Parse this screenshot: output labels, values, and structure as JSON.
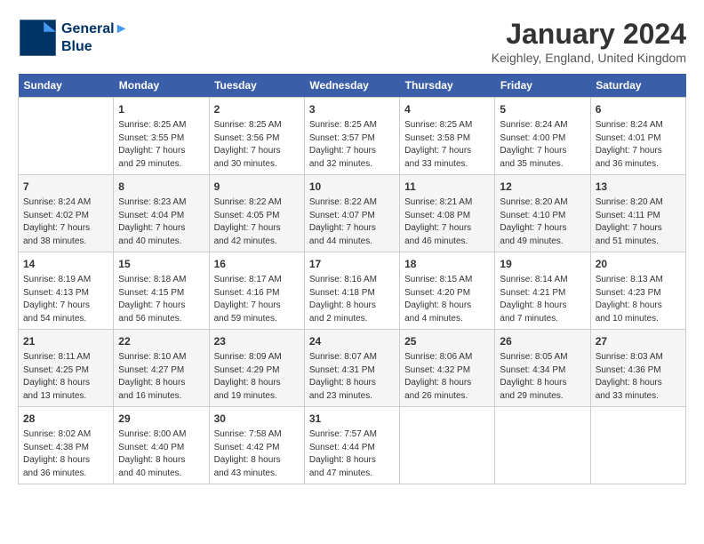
{
  "logo": {
    "line1": "General",
    "line2": "Blue"
  },
  "title": "January 2024",
  "location": "Keighley, England, United Kingdom",
  "days_of_week": [
    "Sunday",
    "Monday",
    "Tuesday",
    "Wednesday",
    "Thursday",
    "Friday",
    "Saturday"
  ],
  "weeks": [
    [
      {
        "day": "",
        "content": ""
      },
      {
        "day": "1",
        "content": "Sunrise: 8:25 AM\nSunset: 3:55 PM\nDaylight: 7 hours\nand 29 minutes."
      },
      {
        "day": "2",
        "content": "Sunrise: 8:25 AM\nSunset: 3:56 PM\nDaylight: 7 hours\nand 30 minutes."
      },
      {
        "day": "3",
        "content": "Sunrise: 8:25 AM\nSunset: 3:57 PM\nDaylight: 7 hours\nand 32 minutes."
      },
      {
        "day": "4",
        "content": "Sunrise: 8:25 AM\nSunset: 3:58 PM\nDaylight: 7 hours\nand 33 minutes."
      },
      {
        "day": "5",
        "content": "Sunrise: 8:24 AM\nSunset: 4:00 PM\nDaylight: 7 hours\nand 35 minutes."
      },
      {
        "day": "6",
        "content": "Sunrise: 8:24 AM\nSunset: 4:01 PM\nDaylight: 7 hours\nand 36 minutes."
      }
    ],
    [
      {
        "day": "7",
        "content": "Sunrise: 8:24 AM\nSunset: 4:02 PM\nDaylight: 7 hours\nand 38 minutes."
      },
      {
        "day": "8",
        "content": "Sunrise: 8:23 AM\nSunset: 4:04 PM\nDaylight: 7 hours\nand 40 minutes."
      },
      {
        "day": "9",
        "content": "Sunrise: 8:22 AM\nSunset: 4:05 PM\nDaylight: 7 hours\nand 42 minutes."
      },
      {
        "day": "10",
        "content": "Sunrise: 8:22 AM\nSunset: 4:07 PM\nDaylight: 7 hours\nand 44 minutes."
      },
      {
        "day": "11",
        "content": "Sunrise: 8:21 AM\nSunset: 4:08 PM\nDaylight: 7 hours\nand 46 minutes."
      },
      {
        "day": "12",
        "content": "Sunrise: 8:20 AM\nSunset: 4:10 PM\nDaylight: 7 hours\nand 49 minutes."
      },
      {
        "day": "13",
        "content": "Sunrise: 8:20 AM\nSunset: 4:11 PM\nDaylight: 7 hours\nand 51 minutes."
      }
    ],
    [
      {
        "day": "14",
        "content": "Sunrise: 8:19 AM\nSunset: 4:13 PM\nDaylight: 7 hours\nand 54 minutes."
      },
      {
        "day": "15",
        "content": "Sunrise: 8:18 AM\nSunset: 4:15 PM\nDaylight: 7 hours\nand 56 minutes."
      },
      {
        "day": "16",
        "content": "Sunrise: 8:17 AM\nSunset: 4:16 PM\nDaylight: 7 hours\nand 59 minutes."
      },
      {
        "day": "17",
        "content": "Sunrise: 8:16 AM\nSunset: 4:18 PM\nDaylight: 8 hours\nand 2 minutes."
      },
      {
        "day": "18",
        "content": "Sunrise: 8:15 AM\nSunset: 4:20 PM\nDaylight: 8 hours\nand 4 minutes."
      },
      {
        "day": "19",
        "content": "Sunrise: 8:14 AM\nSunset: 4:21 PM\nDaylight: 8 hours\nand 7 minutes."
      },
      {
        "day": "20",
        "content": "Sunrise: 8:13 AM\nSunset: 4:23 PM\nDaylight: 8 hours\nand 10 minutes."
      }
    ],
    [
      {
        "day": "21",
        "content": "Sunrise: 8:11 AM\nSunset: 4:25 PM\nDaylight: 8 hours\nand 13 minutes."
      },
      {
        "day": "22",
        "content": "Sunrise: 8:10 AM\nSunset: 4:27 PM\nDaylight: 8 hours\nand 16 minutes."
      },
      {
        "day": "23",
        "content": "Sunrise: 8:09 AM\nSunset: 4:29 PM\nDaylight: 8 hours\nand 19 minutes."
      },
      {
        "day": "24",
        "content": "Sunrise: 8:07 AM\nSunset: 4:31 PM\nDaylight: 8 hours\nand 23 minutes."
      },
      {
        "day": "25",
        "content": "Sunrise: 8:06 AM\nSunset: 4:32 PM\nDaylight: 8 hours\nand 26 minutes."
      },
      {
        "day": "26",
        "content": "Sunrise: 8:05 AM\nSunset: 4:34 PM\nDaylight: 8 hours\nand 29 minutes."
      },
      {
        "day": "27",
        "content": "Sunrise: 8:03 AM\nSunset: 4:36 PM\nDaylight: 8 hours\nand 33 minutes."
      }
    ],
    [
      {
        "day": "28",
        "content": "Sunrise: 8:02 AM\nSunset: 4:38 PM\nDaylight: 8 hours\nand 36 minutes."
      },
      {
        "day": "29",
        "content": "Sunrise: 8:00 AM\nSunset: 4:40 PM\nDaylight: 8 hours\nand 40 minutes."
      },
      {
        "day": "30",
        "content": "Sunrise: 7:58 AM\nSunset: 4:42 PM\nDaylight: 8 hours\nand 43 minutes."
      },
      {
        "day": "31",
        "content": "Sunrise: 7:57 AM\nSunset: 4:44 PM\nDaylight: 8 hours\nand 47 minutes."
      },
      {
        "day": "",
        "content": ""
      },
      {
        "day": "",
        "content": ""
      },
      {
        "day": "",
        "content": ""
      }
    ]
  ]
}
